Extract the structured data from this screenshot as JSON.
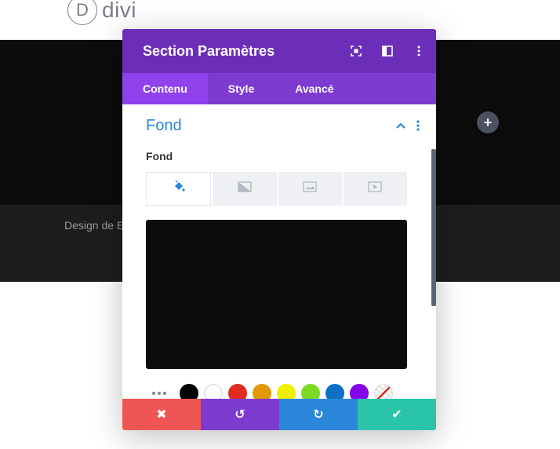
{
  "site": {
    "logo_letter": "D",
    "logo_text": "divi",
    "footer_text": "Design de E"
  },
  "modal": {
    "title": "Section Paramètres",
    "header_icons": [
      "fullscreen-icon",
      "columns-layout-icon",
      "kebab-menu-icon"
    ],
    "tabs": [
      {
        "label": "Contenu",
        "active": true
      },
      {
        "label": "Style",
        "active": false
      },
      {
        "label": "Avancé",
        "active": false
      }
    ],
    "group_title": "Fond",
    "field_label": "Fond",
    "background_types": [
      "paint-bucket-icon",
      "gradient-icon",
      "image-icon",
      "video-icon"
    ],
    "preview_color": "#0c0c0c",
    "swatches": [
      "#000000",
      "#ffffff",
      "#e02b20",
      "#e09900",
      "#edf000",
      "#7cda24",
      "#0c71c3",
      "#8300e9",
      "none"
    ],
    "footer_buttons": [
      {
        "name": "cancel",
        "symbol": "✖",
        "color": "#ef5555"
      },
      {
        "name": "undo",
        "symbol": "↺",
        "color": "#7e3bd0"
      },
      {
        "name": "redo",
        "symbol": "↻",
        "color": "#2b87da"
      },
      {
        "name": "save",
        "symbol": "✔",
        "color": "#29c4a9"
      }
    ]
  },
  "colors": {
    "header": "#6c2eb9",
    "tabs_bar": "#7e3bd0",
    "active_tab": "#8f42ec",
    "accent_blue": "#2b87da"
  }
}
